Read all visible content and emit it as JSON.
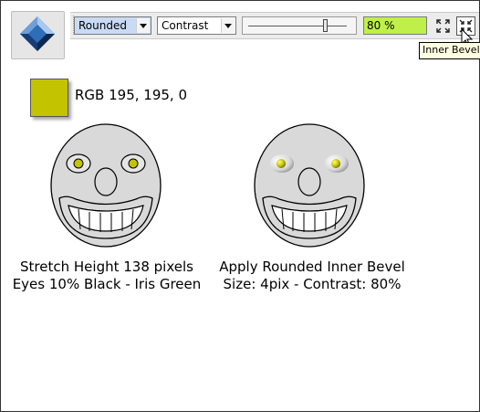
{
  "toolbar": {
    "bevel_type": "Rounded",
    "lighting": "Contrast",
    "contrast_slider": 0.8,
    "contrast_value": "80 %",
    "tooltip": "Inner Bevel"
  },
  "tool_icon": "bevel-tool-icon",
  "icons": [
    "outer-bevel-icon",
    "inner-bevel-icon",
    "mouse-pointer-icon"
  ],
  "colors": {
    "swatch": "#c3c300",
    "field_bg": "#bff04a",
    "face": "#d9d9d9"
  },
  "swatch": {
    "label": "RGB 195, 195, 0"
  },
  "faces": {
    "left": {
      "line1": "Stretch Height 138 pixels",
      "line2": "Eyes 10% Black - Iris Green"
    },
    "right": {
      "line1": "Apply Rounded Inner Bevel",
      "line2": "Size: 4pix - Contrast: 80%"
    }
  }
}
